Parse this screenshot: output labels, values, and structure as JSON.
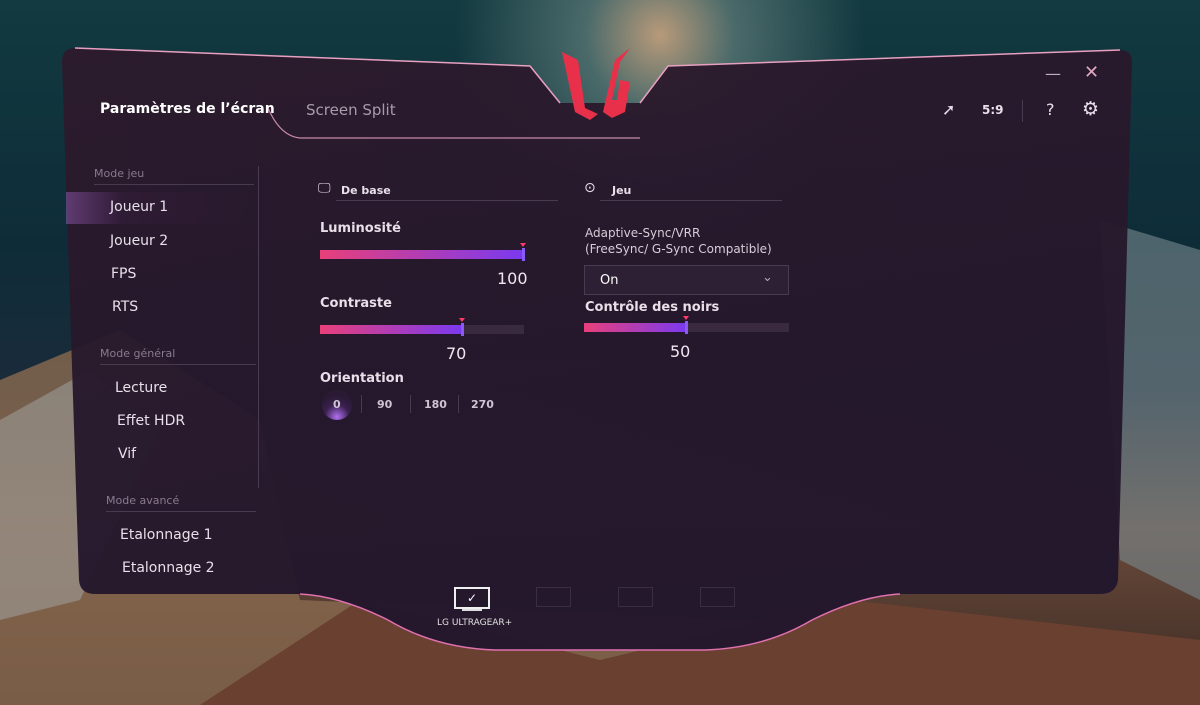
{
  "header": {
    "title": "Paramètres de l’écran",
    "tab_split": "Screen Split",
    "logo": "LG",
    "aspect": "5:9",
    "help": "?"
  },
  "icons": {
    "minimize": "minimize-icon",
    "close": "close-icon",
    "cursor": "cursor-sparkle-icon",
    "settings": "gear-icon"
  },
  "sidebar": {
    "groups": [
      {
        "title": "Mode jeu",
        "items": [
          "Joueur 1",
          "Joueur 2",
          "FPS",
          "RTS"
        ]
      },
      {
        "title": "Mode général",
        "items": [
          "Lecture",
          "Effet HDR",
          "Vif"
        ]
      },
      {
        "title": "Mode avancé",
        "items": [
          "Etalonnage 1",
          "Etalonnage 2"
        ]
      }
    ],
    "selected": "Joueur 1"
  },
  "basic": {
    "title": "De base",
    "brightness": {
      "label": "Luminosité",
      "value": "100",
      "percent": 100
    },
    "contrast": {
      "label": "Contraste",
      "value": "70",
      "percent": 70
    },
    "orientation": {
      "label": "Orientation",
      "options": [
        "0",
        "90",
        "180",
        "270"
      ],
      "selected": "0"
    }
  },
  "game": {
    "title": "Jeu",
    "sync": {
      "label1": "Adaptive-Sync/VRR",
      "label2": "(FreeSync/ G-Sync Compatible)",
      "value": "On"
    },
    "black": {
      "label": "Contrôle des noirs",
      "value": "50",
      "percent": 50
    }
  },
  "monitors": {
    "active": "LG ULTRAGEAR+"
  },
  "colors": {
    "accent_pink": "#e8407a",
    "accent_purple": "#7a3af0",
    "logo": "#e8304a"
  }
}
